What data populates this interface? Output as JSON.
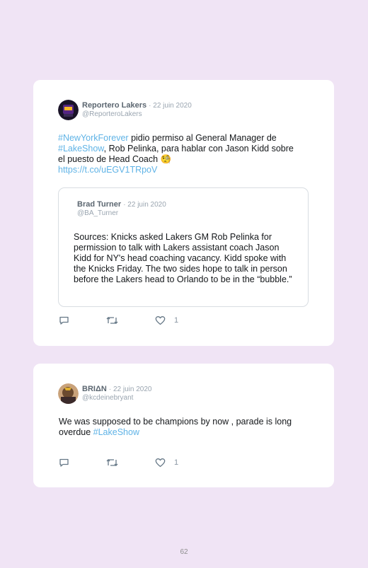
{
  "tweets": [
    {
      "author_name": "Reportero Lakers",
      "date": "· 22 juin 2020",
      "handle": "@ReporteroLakers",
      "text_parts": {
        "hashtag1": "#NewYorkForever",
        "seg1": " pidio permiso al General Manager de ",
        "hashtag2": "#LakeShow",
        "seg2": ", Rob Pelinka, para hablar con Jason Kidd sobre el puesto de Head Coach ",
        "emoji": "🧐",
        "link": "https://t.co/uEGV1TRpoV"
      },
      "quoted": {
        "author_name": "Brad Turner",
        "date": "· 22 juin 2020",
        "handle": "@BA_Turner",
        "text": "Sources: Knicks asked Lakers GM Rob Pelinka for permission to talk with Lakers assistant coach Jason Kidd for NY's head coaching vacancy. Kidd spoke with the Knicks Friday. The two sides hope to talk in person before the Lakers head to Orlando to be in the “bubble.”"
      },
      "like_count": "1",
      "icons": [
        "reply-icon",
        "retweet-icon",
        "heart-icon"
      ]
    },
    {
      "author_name": "BRIΔN",
      "date": "· 22 juin 2020",
      "handle": "@kcdeinebryant",
      "text_parts": {
        "seg1": "We was supposed to be champions by now , parade is long overdue ",
        "hashtag1": "#LakeShow"
      },
      "like_count": "1",
      "icons": [
        "reply-icon",
        "retweet-icon",
        "heart-icon"
      ]
    }
  ],
  "page_number": "62",
  "colors": {
    "background": "#f0e4f5",
    "card": "#ffffff",
    "link": "#5fb3e6",
    "muted": "#9aa5b0"
  }
}
